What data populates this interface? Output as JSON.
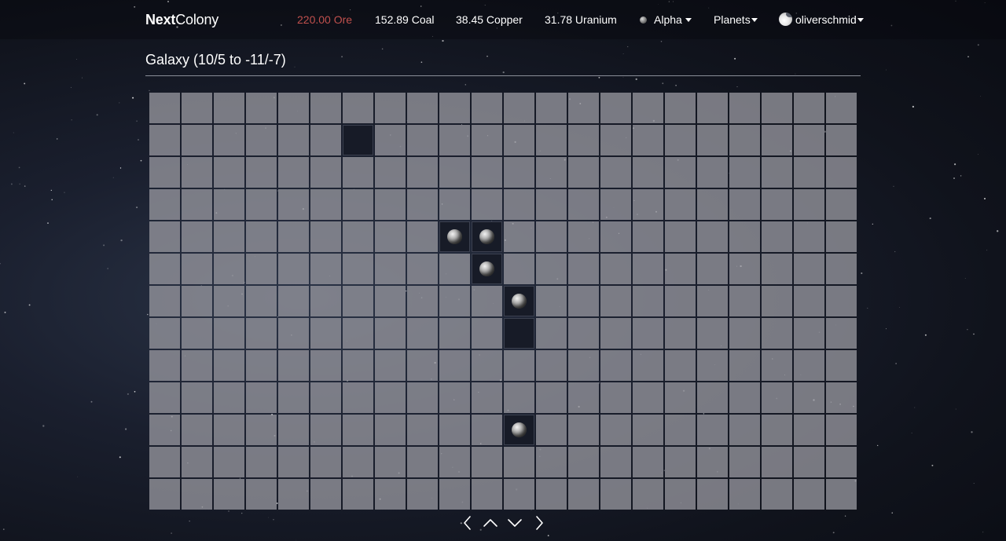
{
  "brand": {
    "part1": "Next",
    "part2": "Colony"
  },
  "resources": {
    "ore": "220.00 Ore",
    "coal": "152.89 Coal",
    "copper": "38.45 Copper",
    "uranium": "31.78 Uranium"
  },
  "colors": {
    "ore_low": "#c0504d",
    "text": "#ffffff",
    "cell": "#96969e",
    "cell_dark": "#171b27"
  },
  "nav": {
    "planet_label": "Alpha",
    "planets_label": "Planets",
    "user_label": "oliverschmid"
  },
  "page": {
    "title": "Galaxy (10/5 to -11/-7)"
  },
  "grid": {
    "columns": 22,
    "rows": 13,
    "x_range": [
      10,
      -11
    ],
    "y_range": [
      5,
      -7
    ],
    "cells": [
      {
        "row": 1,
        "col": 6,
        "state": "explored"
      },
      {
        "row": 4,
        "col": 9,
        "state": "planet"
      },
      {
        "row": 4,
        "col": 10,
        "state": "planet"
      },
      {
        "row": 5,
        "col": 10,
        "state": "planet"
      },
      {
        "row": 6,
        "col": 11,
        "state": "planet"
      },
      {
        "row": 7,
        "col": 11,
        "state": "explored"
      },
      {
        "row": 10,
        "col": 11,
        "state": "planet"
      }
    ]
  },
  "icons": {
    "left": "chevron-left-icon",
    "up": "chevron-up-icon",
    "down": "chevron-down-icon",
    "right": "chevron-right-icon"
  }
}
